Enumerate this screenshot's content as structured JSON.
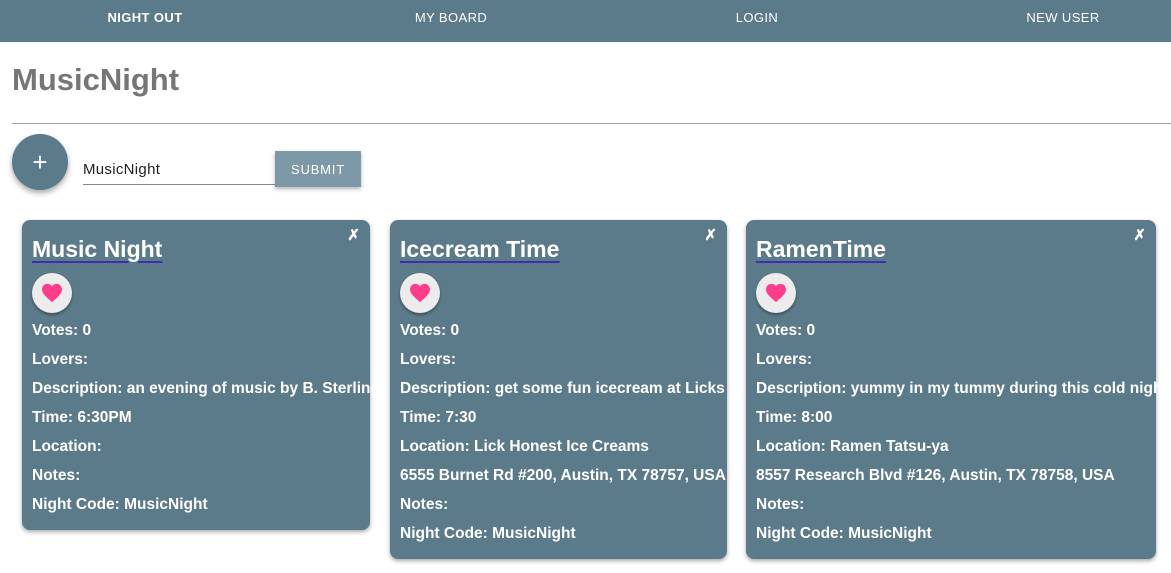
{
  "nav": {
    "items": [
      {
        "label": "NIGHT OUT"
      },
      {
        "label": "MY BOARD"
      },
      {
        "label": "LOGIN"
      },
      {
        "label": "NEW USER"
      }
    ]
  },
  "page": {
    "title": "MusicNight",
    "add_icon": "+",
    "code_input_value": "MusicNight",
    "submit_label": "SUBMIT"
  },
  "colors": {
    "primary": "#5b7b8b",
    "submit": "#7d98a6",
    "heart": "#ff3d8b",
    "title_underline": "#3f2fb0"
  },
  "cards": [
    {
      "title": "Music Night",
      "close": "✗",
      "votes": "Votes: 0",
      "lovers": "Lovers:",
      "description": "Description: an evening of music by B. Sterling",
      "time": "Time: 6:30PM",
      "location": "Location:",
      "address": "",
      "notes": "Notes:",
      "night_code": "Night Code: MusicNight"
    },
    {
      "title": "Icecream Time",
      "close": "✗",
      "votes": "Votes: 0",
      "lovers": "Lovers:",
      "description": "Description: get some fun icecream at Licks",
      "time": "Time: 7:30",
      "location": "Location: Lick Honest Ice Creams",
      "address": "6555 Burnet Rd #200, Austin, TX 78757, USA",
      "notes": "Notes:",
      "night_code": "Night Code: MusicNight"
    },
    {
      "title": "RamenTime",
      "close": "✗",
      "votes": "Votes: 0",
      "lovers": "Lovers:",
      "description": "Description: yummy in my tummy during this cold night",
      "time": "Time: 8:00",
      "location": "Location: Ramen Tatsu-ya",
      "address": "8557 Research Blvd #126, Austin, TX 78758, USA",
      "notes": "Notes:",
      "night_code": "Night Code: MusicNight"
    }
  ]
}
